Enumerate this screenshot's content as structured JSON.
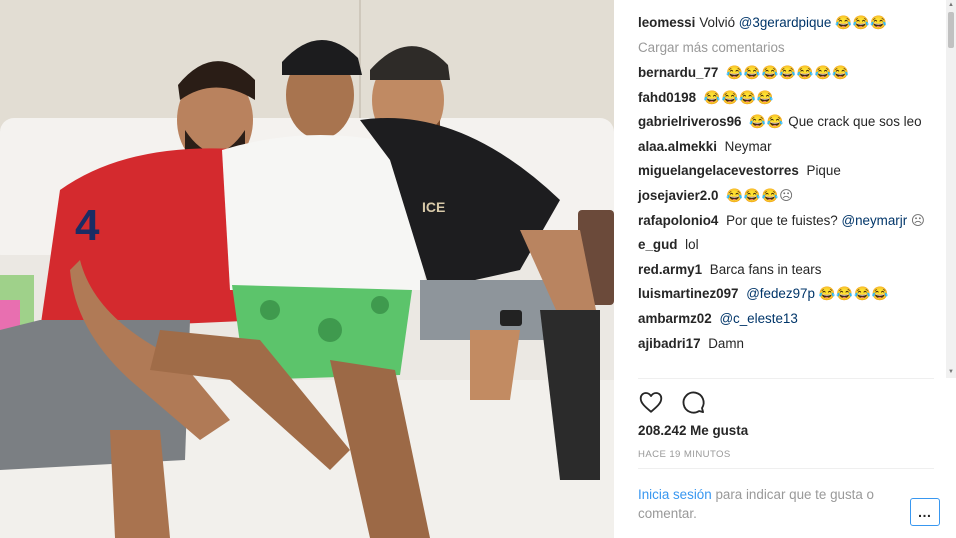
{
  "post": {
    "author_comment": {
      "username": "leomessi",
      "text": "Volvió",
      "mention": "@3gerardpique",
      "emoji": "😂😂😂"
    },
    "load_more_label": "Cargar más comentarios",
    "comments": [
      {
        "username": "bernardu_77",
        "text": "",
        "mention": "",
        "emoji": "😂😂😂😂😂😂😂"
      },
      {
        "username": "fahd0198",
        "text": "",
        "mention": "",
        "emoji": "😂😂😂😂"
      },
      {
        "username": "gabrielriveros96",
        "text": "",
        "mention": "",
        "emoji": "😂😂",
        "text_after": "Que crack que sos leo"
      },
      {
        "username": "alaa.almekki",
        "text": "Neymar",
        "mention": "",
        "emoji": ""
      },
      {
        "username": "miguelangelacevestorres",
        "text": "Pique",
        "mention": "",
        "emoji": ""
      },
      {
        "username": "josejavier2.0",
        "text": "",
        "mention": "",
        "emoji": "😂😂😂☹"
      },
      {
        "username": "rafapolonio4",
        "text": "Por que te fuistes?",
        "mention": "@neymarjr",
        "emoji": "☹"
      },
      {
        "username": "e_gud",
        "text": "lol",
        "mention": "",
        "emoji": ""
      },
      {
        "username": "red.army1",
        "text": "Barca fans in tears",
        "mention": "",
        "emoji": ""
      },
      {
        "username": "luismartinez097",
        "text": "",
        "mention": "@fedez97p",
        "emoji": "😂😂😂😂"
      },
      {
        "username": "ambarmz02",
        "text": "",
        "mention": "@c_eleste13",
        "emoji": ""
      },
      {
        "username": "ajibadri17",
        "text": "Damn",
        "mention": "",
        "emoji": ""
      }
    ],
    "likes_label": "208.242 Me gusta",
    "timestamp": "HACE 19 MINUTOS",
    "login_link": "Inicia sesión",
    "login_text": "para indicar que te gusta o comentar.",
    "more_options": "…",
    "icons": [
      "heart-icon",
      "comment-icon",
      "more-options-icon"
    ]
  },
  "colors": {
    "link": "#3897f0",
    "mention": "#003569",
    "muted": "#999999",
    "text": "#262626"
  }
}
